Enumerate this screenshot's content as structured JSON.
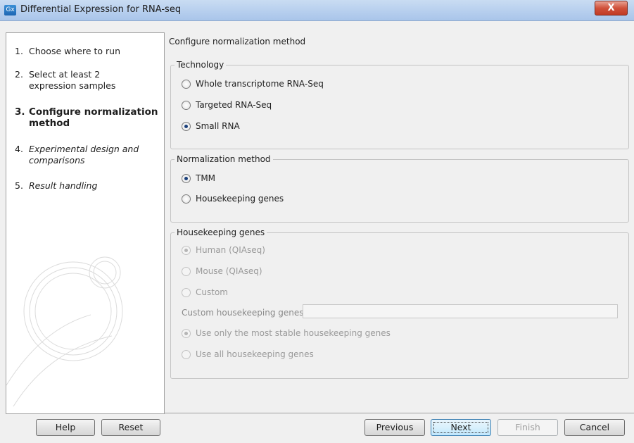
{
  "window": {
    "title": "Differential Expression for RNA-seq",
    "app_icon_text": "Gx",
    "close_symbol": "X"
  },
  "wizard": {
    "steps": [
      {
        "number": "1.",
        "label": "Choose where to run",
        "state": "done"
      },
      {
        "number": "2.",
        "label": "Select at least 2 expression samples",
        "state": "done"
      },
      {
        "number": "3.",
        "label": "Configure normalization method",
        "state": "current"
      },
      {
        "number": "4.",
        "label": "Experimental design and comparisons",
        "state": "future"
      },
      {
        "number": "5.",
        "label": "Result handling",
        "state": "future"
      }
    ]
  },
  "main": {
    "title": "Configure normalization method",
    "technology": {
      "legend": "Technology",
      "options": [
        {
          "label": "Whole transcriptome RNA-Seq",
          "checked": false
        },
        {
          "label": "Targeted RNA-Seq",
          "checked": false
        },
        {
          "label": "Small RNA",
          "checked": true
        }
      ]
    },
    "normalization": {
      "legend": "Normalization method",
      "options": [
        {
          "label": "TMM",
          "checked": true
        },
        {
          "label": "Housekeeping genes",
          "checked": false
        }
      ]
    },
    "housekeeping": {
      "legend": "Housekeeping genes",
      "enabled": false,
      "species_options": [
        {
          "label": "Human (QIAseq)",
          "checked": true
        },
        {
          "label": "Mouse (QIAseq)",
          "checked": false
        },
        {
          "label": "Custom",
          "checked": false
        }
      ],
      "custom_label": "Custom housekeeping genes",
      "custom_value": "",
      "selection_options": [
        {
          "label": "Use only the most stable housekeeping genes",
          "checked": true
        },
        {
          "label": "Use all housekeeping genes",
          "checked": false
        }
      ]
    }
  },
  "buttons": {
    "help": "Help",
    "reset": "Reset",
    "previous": "Previous",
    "next": "Next",
    "finish": "Finish",
    "cancel": "Cancel"
  },
  "colors": {
    "titlebar": "#b7cfee",
    "close_button": "#d0513b",
    "dialog_background": "#f0f0f0",
    "default_button_border": "#3c7fb1"
  }
}
